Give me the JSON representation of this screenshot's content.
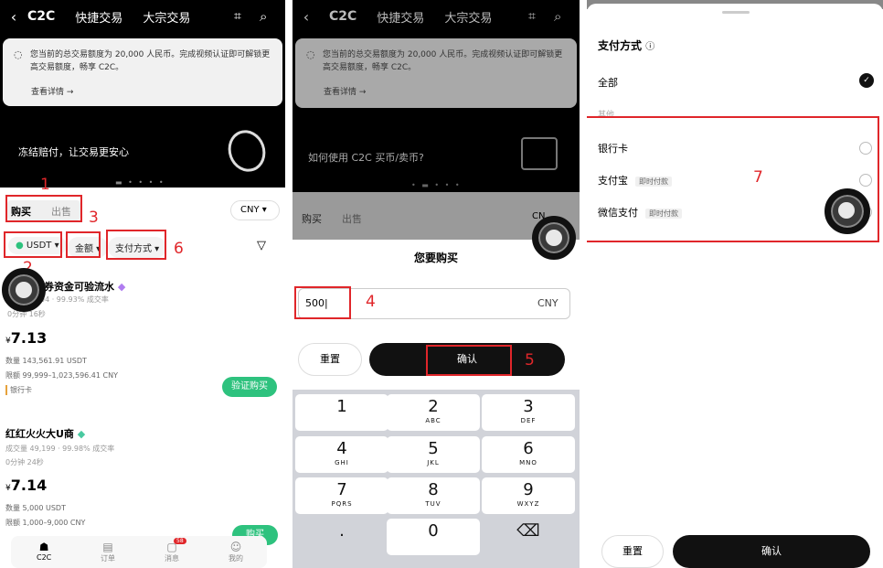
{
  "p1": {
    "tabs": [
      "C2C",
      "快捷交易",
      "大宗交易"
    ],
    "notice_text": "您当前的总交易额度为 20,000 人民币。完成视频认证即可解锁更高交易额度，畅享 C2C。",
    "notice_more": "查看详情 →",
    "banner_text": "冻结赔付，让交易更安心",
    "buy": "购买",
    "sell": "出售",
    "currency": "CNY",
    "filters": {
      "coin": "USDT",
      "amount": "金额",
      "pay": "支付方式"
    },
    "ann": [
      "1",
      "2",
      "3",
      "6"
    ],
    "m1": {
      "name": "券资金可验流水",
      "stats1": "94 · 99.93% 成交率",
      "stats2": "0分钟 16秒",
      "price": "7.13",
      "qty": "数量 143,561.91 USDT",
      "limit": "限额 99,999–1,023,596.41 CNY",
      "method": "银行卡",
      "btn": "验证购买"
    },
    "m2": {
      "name": "红红火火大U商",
      "stats1": "成交量 49,199 · 99.98% 成交率",
      "stats2": "0分钟 24秒",
      "price": "7.14",
      "qty": "数量 5,000 USDT",
      "limit": "限额 1,000–9,000 CNY",
      "btn": "购买"
    },
    "nav": [
      "C2C",
      "订单",
      "消息",
      "我的"
    ],
    "badge": "58"
  },
  "p2": {
    "tabs": [
      "C2C",
      "快捷交易",
      "大宗交易"
    ],
    "notice_text": "您当前的总交易额度为 20,000 人民币。完成视频认证即可解锁更高交易额度，畅享 C2C。",
    "notice_more": "查看详情 →",
    "banner_text": "如何使用 C2C 买币/卖币?",
    "buy": "购买",
    "sell": "出售",
    "cny_short": "CN",
    "sheet_title": "您要购买",
    "amount": "500",
    "unit": "CNY",
    "reset": "重置",
    "confirm": "确认",
    "ann": [
      "4",
      "5"
    ],
    "keys": [
      [
        "1",
        ""
      ],
      [
        "2",
        "ABC"
      ],
      [
        "3",
        "DEF"
      ],
      [
        "4",
        "GHI"
      ],
      [
        "5",
        "JKL"
      ],
      [
        "6",
        "MNO"
      ],
      [
        "7",
        "PQRS"
      ],
      [
        "8",
        "TUV"
      ],
      [
        "9",
        "WXYZ"
      ],
      [
        ".",
        ""
      ],
      [
        "0",
        ""
      ],
      [
        "⌫",
        ""
      ]
    ]
  },
  "p3": {
    "title": "支付方式",
    "all": "全部",
    "other": "其他",
    "items": [
      {
        "name": "银行卡",
        "tag": ""
      },
      {
        "name": "支付宝",
        "tag": "即时付款"
      },
      {
        "name": "微信支付",
        "tag": "即时付款"
      }
    ],
    "ann": "7",
    "reset": "重置",
    "confirm": "确认"
  }
}
